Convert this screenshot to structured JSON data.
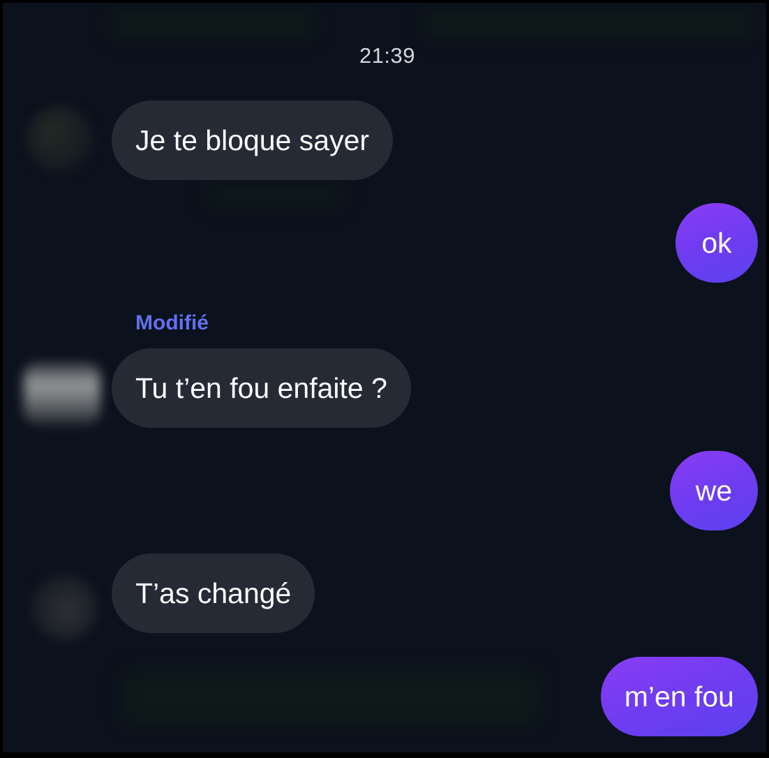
{
  "conversation": {
    "timestamp": "21:39",
    "edited_label": "Modifié",
    "messages": [
      {
        "from": "other",
        "text": "Je te bloque sayer"
      },
      {
        "from": "me",
        "text": "ok"
      },
      {
        "from": "other",
        "text": "Tu t’en fou enfaite ?",
        "edited": true
      },
      {
        "from": "me",
        "text": "we"
      },
      {
        "from": "other",
        "text": "T’as changé"
      },
      {
        "from": "me",
        "text": "m’en fou"
      }
    ]
  },
  "colors": {
    "background": "#0b111d",
    "incoming_bubble": "#262a35",
    "outgoing_bubble": "#7a3cf2",
    "edited_label": "#6270ee",
    "text": "#ffffff"
  }
}
